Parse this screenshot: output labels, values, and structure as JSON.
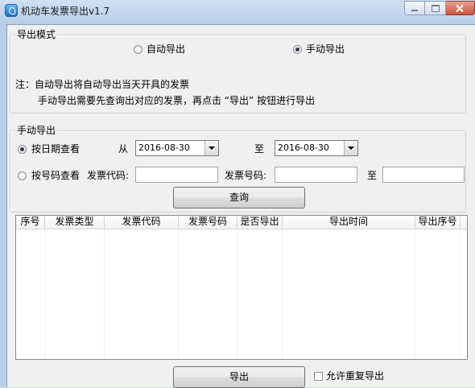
{
  "window": {
    "title": "机动车发票导出v1.7"
  },
  "export_mode": {
    "group_title": "导出模式",
    "auto_label": "自动导出",
    "manual_label": "手动导出",
    "selected": "manual",
    "note_line1": "注：自动导出将自动导出当天开具的发票",
    "note_line2": "手动导出需要先查询出对应的发票，再点击 “导出” 按钮进行导出"
  },
  "manual_export": {
    "group_title": "手动导出",
    "by_date_label": "按日期查看",
    "by_date_selected": true,
    "from_label": "从",
    "from_date": "2016-08-30",
    "to_label": "至",
    "to_date": "2016-08-30",
    "by_number_label": "按号码查看",
    "by_number_selected": false,
    "invoice_code_label": "发票代码:",
    "invoice_code_value": "",
    "invoice_number_label": "发票号码:",
    "invoice_number_from": "",
    "to_label_2": "至",
    "invoice_number_to": "",
    "query_button": "查询"
  },
  "table": {
    "columns": [
      "序号",
      "发票类型",
      "发票代码",
      "发票号码",
      "是否导出",
      "导出时间",
      "导出序号"
    ],
    "rows": []
  },
  "footer": {
    "export_button": "导出",
    "allow_repeat_label": "允许重复导出",
    "allow_repeat_checked": false
  }
}
